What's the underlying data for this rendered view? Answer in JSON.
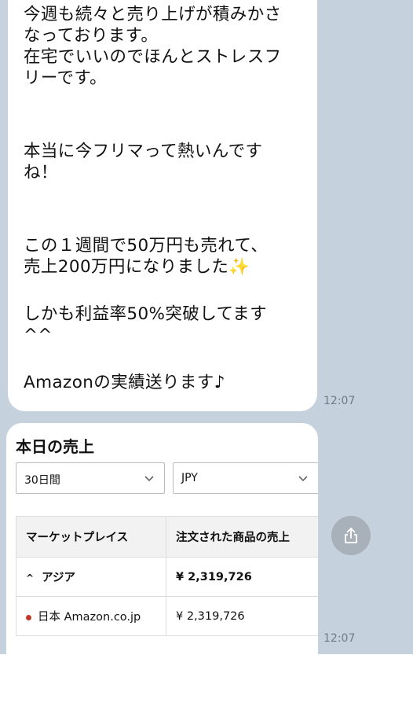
{
  "message": {
    "lines": [
      "今週も続々と売り上げが積みかさ",
      "なっております。",
      "在宅でいいのでほんとストレスフ",
      "リーです。",
      "",
      "",
      "本当に今フリマって熱いんです",
      "ね！",
      "",
      "",
      "この１週間で50万円も売れて、",
      "売上200万円になりました✨",
      "",
      "しかも利益率50%突破してます",
      "^^",
      "",
      "Amazonの実績送ります♪"
    ],
    "time": "12:07"
  },
  "sales_card": {
    "title": "本日の売上",
    "period_select": "30日間",
    "currency_select": "JPY",
    "table": {
      "headers": [
        "マーケットプレイス",
        "注文された商品の売上"
      ],
      "rows": [
        {
          "marketplace": "アジア",
          "sales": "¥ 2,319,726"
        },
        {
          "marketplace": "日本 Amazon.co.jp",
          "sales": "¥ 2,319,726"
        }
      ]
    },
    "time": "12:07"
  },
  "icons": {
    "share": "share-icon",
    "chevron": "chevron-down-icon",
    "region_bullet": "dot-icon"
  },
  "colors": {
    "chat_background": "#c5d2de",
    "bubble": "#ffffff",
    "share_button": "#a8b1ba",
    "bullet": "#c0392b"
  }
}
